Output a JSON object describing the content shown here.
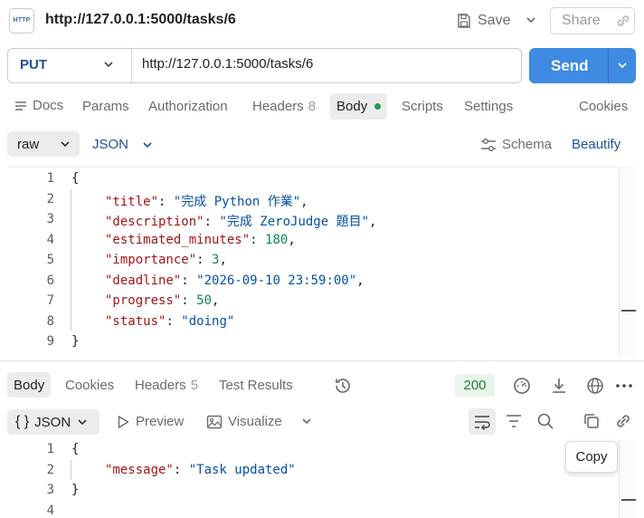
{
  "header": {
    "request_title": "http://127.0.0.1:5000/tasks/6",
    "http_icon_text": "HTTP",
    "save_label": "Save",
    "share_label": "Share"
  },
  "request": {
    "method": "PUT",
    "url": "http://127.0.0.1:5000/tasks/6",
    "send_label": "Send"
  },
  "request_tabs": {
    "docs": "Docs",
    "params": "Params",
    "authorization": "Authorization",
    "headers": "Headers",
    "headers_count": "8",
    "body": "Body",
    "scripts": "Scripts",
    "settings": "Settings",
    "cookies": "Cookies"
  },
  "body_toolbar": {
    "mode": "raw",
    "language": "JSON",
    "schema_label": "Schema",
    "beautify_label": "Beautify"
  },
  "request_body": {
    "line_numbers": [
      "1",
      "2",
      "3",
      "4",
      "5",
      "6",
      "7",
      "8",
      "9"
    ],
    "open_brace": "{",
    "close_brace": "}",
    "fields": [
      {
        "key": "\"title\"",
        "value": "\"完成 Python 作業\"",
        "sep": ","
      },
      {
        "key": "\"description\"",
        "value": "\"完成 ZeroJudge 題目\"",
        "sep": ","
      },
      {
        "key": "\"estimated_minutes\"",
        "value": "180",
        "sep": ","
      },
      {
        "key": "\"importance\"",
        "value": "3",
        "sep": ","
      },
      {
        "key": "\"deadline\"",
        "value": "\"2026-09-10 23:59:00\"",
        "sep": ","
      },
      {
        "key": "\"progress\"",
        "value": "50",
        "sep": ","
      },
      {
        "key": "\"status\"",
        "value": "\"doing\"",
        "sep": ""
      }
    ]
  },
  "response_tabs": {
    "body": "Body",
    "cookies": "Cookies",
    "headers": "Headers",
    "headers_count": "5",
    "test_results": "Test Results",
    "status_code": "200"
  },
  "response_toolbar": {
    "format": "JSON",
    "format_icon": "{ }",
    "preview_label": "Preview",
    "visualize_label": "Visualize",
    "copy_tooltip": "Copy"
  },
  "response_body": {
    "line_numbers": [
      "1",
      "2",
      "3",
      "4"
    ],
    "open_brace": "{",
    "close_brace": "}",
    "key": "\"message\"",
    "value": "\"Task updated\""
  },
  "colors": {
    "accent": "#3f8ae2",
    "method": "#1f4f9e",
    "json_key": "#a31515",
    "json_string": "#0451a5",
    "json_number": "#098658",
    "status_ok": "#1f7a3a"
  },
  "icons": [
    "http-icon",
    "save-icon",
    "chevron-down-icon",
    "link-icon",
    "docs-icon",
    "schema-icon",
    "history-icon",
    "time-icon",
    "download-icon",
    "globe-icon",
    "more-icon",
    "play-icon",
    "image-icon",
    "wrap-icon",
    "filter-icon",
    "search-icon",
    "copy-icon"
  ]
}
